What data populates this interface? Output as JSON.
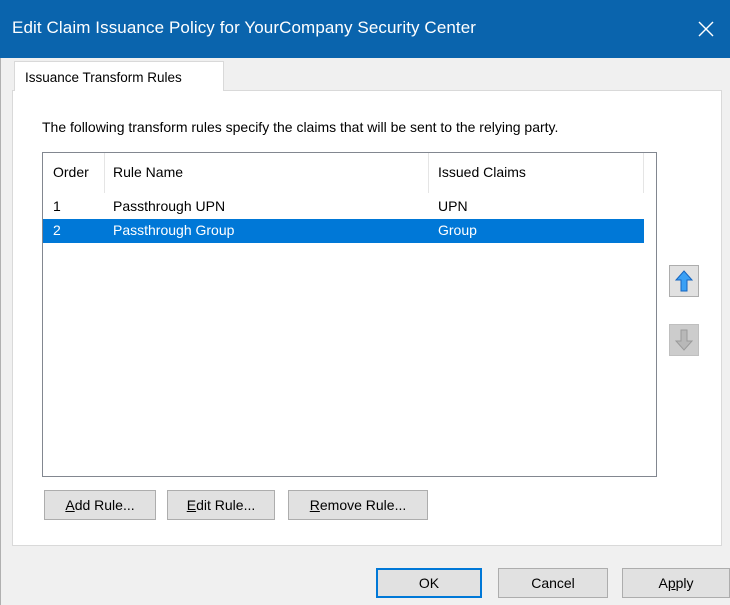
{
  "window": {
    "title": "Edit Claim Issuance Policy for YourCompany Security Center"
  },
  "tabs": [
    {
      "label": "Issuance Transform Rules",
      "active": true
    }
  ],
  "description": "The following transform rules specify the claims that will be sent to the relying party.",
  "rules_table": {
    "columns": [
      "Order",
      "Rule Name",
      "Issued Claims"
    ],
    "rows": [
      {
        "order": "1",
        "rule_name": "Passthrough UPN",
        "issued_claims": "UPN",
        "selected": false
      },
      {
        "order": "2",
        "rule_name": "Passthrough Group",
        "issued_claims": "Group",
        "selected": true
      }
    ]
  },
  "side_buttons": {
    "move_up_icon": "arrow-up-icon",
    "move_down_icon": "arrow-down-icon"
  },
  "rule_buttons": {
    "add": {
      "prefix": "",
      "mnemonic": "A",
      "rest": "dd Rule..."
    },
    "edit": {
      "prefix": "",
      "mnemonic": "E",
      "rest": "dit Rule..."
    },
    "remove": {
      "prefix": "",
      "mnemonic": "R",
      "rest": "emove Rule..."
    }
  },
  "dialog_buttons": {
    "ok": "OK",
    "cancel": "Cancel",
    "apply": {
      "prefix": "A",
      "mnemonic": "p",
      "rest": "ply"
    }
  },
  "colors": {
    "titlebar": "#0a64ad",
    "selection": "#0078d7",
    "up_arrow": "#1e90ff",
    "down_arrow_disabled": "#a0a0a0"
  }
}
